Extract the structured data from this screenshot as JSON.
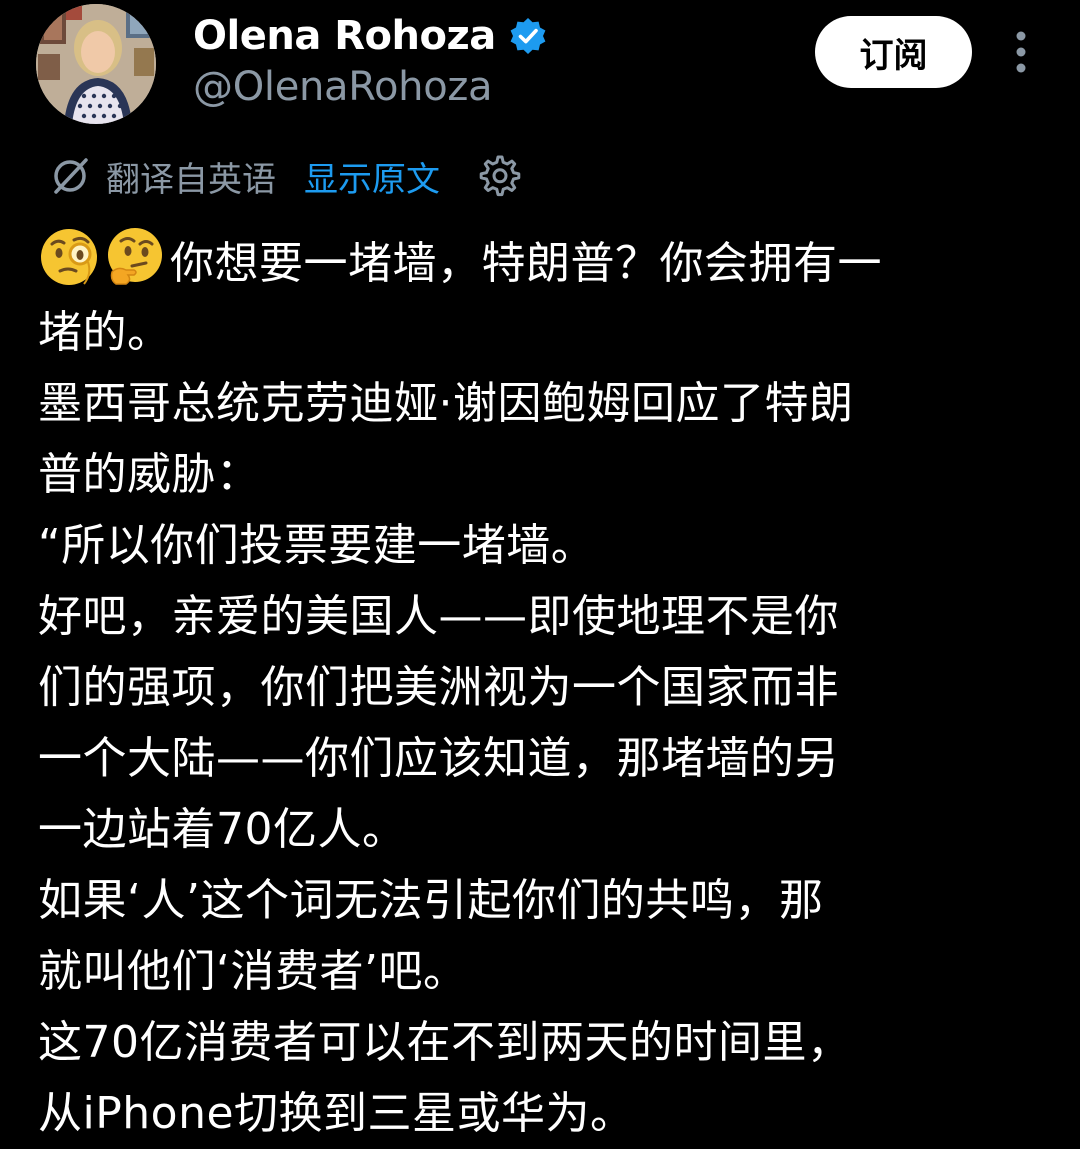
{
  "author": {
    "display_name": "Olena Rohoza",
    "handle": "@OlenaRohoza",
    "verified": true,
    "avatar_icon": "profile-photo"
  },
  "actions": {
    "subscribe_label": "订阅",
    "more_icon": "more-vertical-icon"
  },
  "translation": {
    "icon": "translate-icon",
    "translated_from": "翻译自英语",
    "show_original": "显示原文",
    "settings_icon": "gear-icon"
  },
  "tweet": {
    "emojis": [
      "face-with-monocle",
      "thinking-face"
    ],
    "lines": [
      "你想要一堵墙，特朗普？你会拥有一",
      "堵的。",
      "墨西哥总统克劳迪娅·谢因鲍姆回应了特朗",
      "普的威胁：",
      "“所以你们投票要建一堵墙。",
      "好吧，亲爱的美国人——即使地理不是你",
      "们的强项，你们把美洲视为一个国家而非",
      "一个大陆——你们应该知道，那堵墙的另",
      "一边站着70亿人。",
      "如果‘人’这个词无法引起你们的共鸣，那",
      "就叫他们‘消费者’吧。",
      "这70亿消费者可以在不到两天的时间里，",
      "从iPhone切换到三星或华为。"
    ]
  },
  "colors": {
    "background": "#000000",
    "text": "#ffffff",
    "muted": "#8b98a5",
    "link": "#1d9bf0",
    "verified": "#1d9bf0"
  }
}
